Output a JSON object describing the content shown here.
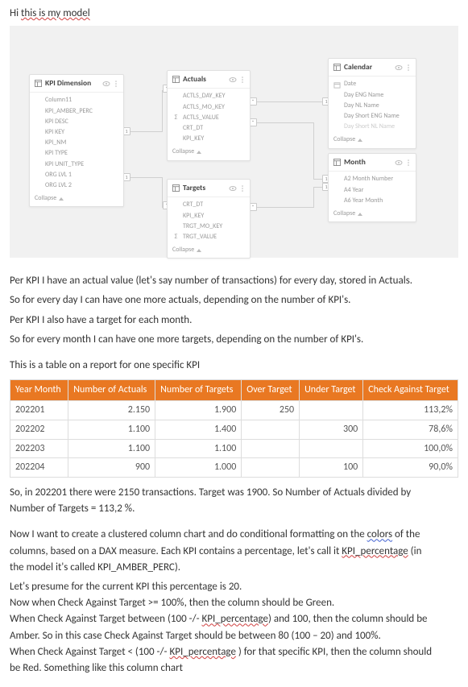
{
  "intro": "Hi this is my model",
  "intro_wavy_span": "this is my model",
  "diagram": {
    "cards": {
      "kpi_dimension": {
        "title": "KPI Dimension",
        "fields": [
          "Column11",
          "KPI_AMBER_PERC",
          "KPI DESC",
          "KPI KEY",
          "KPI_NM",
          "KPI TYPE",
          "KPI UNIT_TYPE",
          "ORG LVL 1",
          "ORG LVL 2"
        ],
        "collapse": "Collapse"
      },
      "actuals": {
        "title": "Actuals",
        "fields": [
          {
            "name": "ACTLS_DAY_KEY",
            "sigma": false
          },
          {
            "name": "ACTLS_MO_KEY",
            "sigma": false
          },
          {
            "name": "ACTLS_VALUE",
            "sigma": true
          },
          {
            "name": "CRT_DT",
            "sigma": false
          },
          {
            "name": "KPI_KEY",
            "sigma": false
          }
        ],
        "collapse": "Collapse"
      },
      "targets": {
        "title": "Targets",
        "fields": [
          {
            "name": "CRT_DT",
            "sigma": false
          },
          {
            "name": "KPI_KEY",
            "sigma": false
          },
          {
            "name": "TRGT_MO_KEY",
            "sigma": false
          },
          {
            "name": "TRGT_VALUE",
            "sigma": true
          }
        ],
        "collapse": "Collapse"
      },
      "calendar": {
        "title": "Calendar",
        "fields": [
          "Date",
          "Day ENG Name",
          "Day NL Name",
          "Day Short ENG Name",
          "Day Short NL Name"
        ],
        "collapse": "Collapse"
      },
      "month": {
        "title": "Month",
        "fields": [
          "A2 Month Number",
          "A4 Year",
          "A6 Year Month"
        ],
        "collapse": "Collapse"
      }
    }
  },
  "paragraphs": {
    "p1": "Per KPI I have an actual value (let's say number of transactions) for every day, stored in Actuals.",
    "p2": "So for every day I can have one more actuals, depending on the number of KPI's.",
    "p3": "Per KPI I also have a target for each month.",
    "p4": "So for every month I can have one more targets, depending on the number of KPI's.",
    "p5": "This is a table on a report for one specific KPI"
  },
  "table": {
    "headers": [
      "Year Month",
      "Number of Actuals",
      "Number of Targets",
      "Over Target",
      "Under Target",
      "Check Against Target"
    ],
    "rows": [
      {
        "ym": "202201",
        "actuals": "2.150",
        "targets": "1.900",
        "over": "250",
        "under": "",
        "check": "113,2%"
      },
      {
        "ym": "202202",
        "actuals": "1.100",
        "targets": "1.400",
        "over": "",
        "under": "300",
        "check": "78,6%"
      },
      {
        "ym": "202203",
        "actuals": "1.100",
        "targets": "1.100",
        "over": "",
        "under": "",
        "check": "100,0%"
      },
      {
        "ym": "202204",
        "actuals": "900",
        "targets": "1.000",
        "over": "",
        "under": "100",
        "check": "90,0%"
      }
    ]
  },
  "body": {
    "b1a": "So, in 202201 there were 2150 transactions. Target was 1900. So Number of Actuals divided by",
    "b1b": "Number of Targets = 113,2 %.",
    "b2a_1": "Now I want to create a clustered column chart and do conditional formatting  on the ",
    "b2a_colors": "colors",
    "b2a_2": " of the",
    "b2b_1": "columns, based on a DAX measure. Each KPI contains a percentage, let's call it ",
    "b2b_kpi": "KPI_percentage",
    "b2b_2": " (in",
    "b2c": "the model it's called KPI_AMBER_PERC).",
    "b3": "Let's presume for the current KPI this percentage is 20.",
    "b4": "Now when Check Against Target >= 100%, then the column should be Green.",
    "b5a_1": "When Check Against Target between (100  -/- ",
    "b5a_kpi": "KPI_percentage",
    "b5a_2": ") and 100, then the column should be",
    "b5b": "Amber. So in this case Check Against Target should be between 80 (100 – 20)  and 100%.",
    "b6a_1": "When Check Against Target < (100 -/- ",
    "b6a_kpi": "KPI_percentage",
    "b6a_2": " ) for that specific KPI, then the column should",
    "b6b": "be Red. Something like this column chart"
  }
}
